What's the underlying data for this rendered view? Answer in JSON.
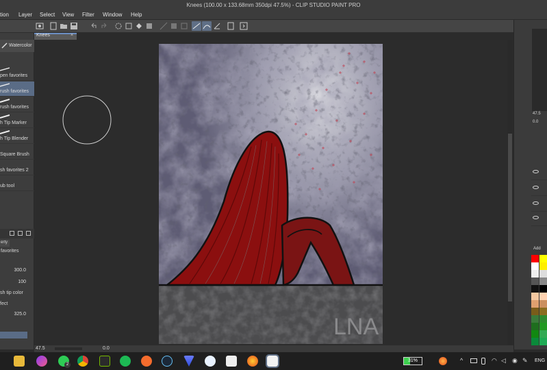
{
  "window": {
    "title": "Knees (100.00 x 133.68mm 350dpi 47.5%)  -  CLIP STUDIO PAINT PRO"
  },
  "menu": [
    "tion",
    "Layer",
    "Select",
    "View",
    "Filter",
    "Window",
    "Help"
  ],
  "document_tab": {
    "label": "Knees",
    "close": "×"
  },
  "brush_panel": {
    "header": "Watercolor",
    "items": [
      {
        "label": "pen favorites",
        "selected": false
      },
      {
        "label": "rush favorites",
        "selected": true
      },
      {
        "label": "rush favorites",
        "selected": false
      },
      {
        "label": "h Tip Marker",
        "selected": false
      },
      {
        "label": "h Tip Blender",
        "selected": false
      },
      {
        "label": "Square Brush",
        "selected": false
      },
      {
        "label": "sh favorites 2",
        "selected": false
      },
      {
        "label": "ub tool",
        "selected": false
      }
    ]
  },
  "tool_property": {
    "tab": "erty",
    "header": "favorites",
    "brush_size": "300.0",
    "opacity": "100",
    "tip_color_label": "sh tip color",
    "effect_label": "fect",
    "density": "325.0"
  },
  "statusbar": {
    "zoom": "47.5",
    "rotation": "0.0"
  },
  "navigator": {
    "zoom": "47.5",
    "rotation": "0.0"
  },
  "layer_panel": {
    "mode_label": "Add"
  },
  "colors": {
    "accent": "#6d8fc4",
    "hair": "#8b0f0f",
    "body": "#7a1414",
    "sky": "#5e5c74",
    "ground": "#4c4c4e",
    "swatches": [
      "#ff0000",
      "#ffff00",
      "#ffffff",
      "#ffee00",
      "#eeeeee",
      "#dddddd",
      "#555555",
      "#888888",
      "#111111",
      "#000000",
      "#f4c8a0",
      "#ffd2b0",
      "#e0a070",
      "#cc9060",
      "#7a5c1a",
      "#8a6d1f",
      "#3a7a3a",
      "#2e8b2e",
      "#1e6e1e",
      "#229922",
      "#118811",
      "#33aa55",
      "#0a8a3a",
      "#1faa55"
    ]
  },
  "taskbar": {
    "battery": "31%",
    "language": "ENG",
    "apps": [
      "file-explorer-icon",
      "messenger-icon",
      "whatsapp-icon",
      "chrome-icon",
      "nvidia-icon",
      "spotify-icon",
      "origin-icon",
      "steam-icon",
      "vpn-icon",
      "word-icon",
      "clip-studio-icon",
      "firefox-icon",
      "clip-studio-paint-icon"
    ],
    "whatsapp_badge": "2"
  },
  "artwork": {
    "signature": "LNA"
  }
}
